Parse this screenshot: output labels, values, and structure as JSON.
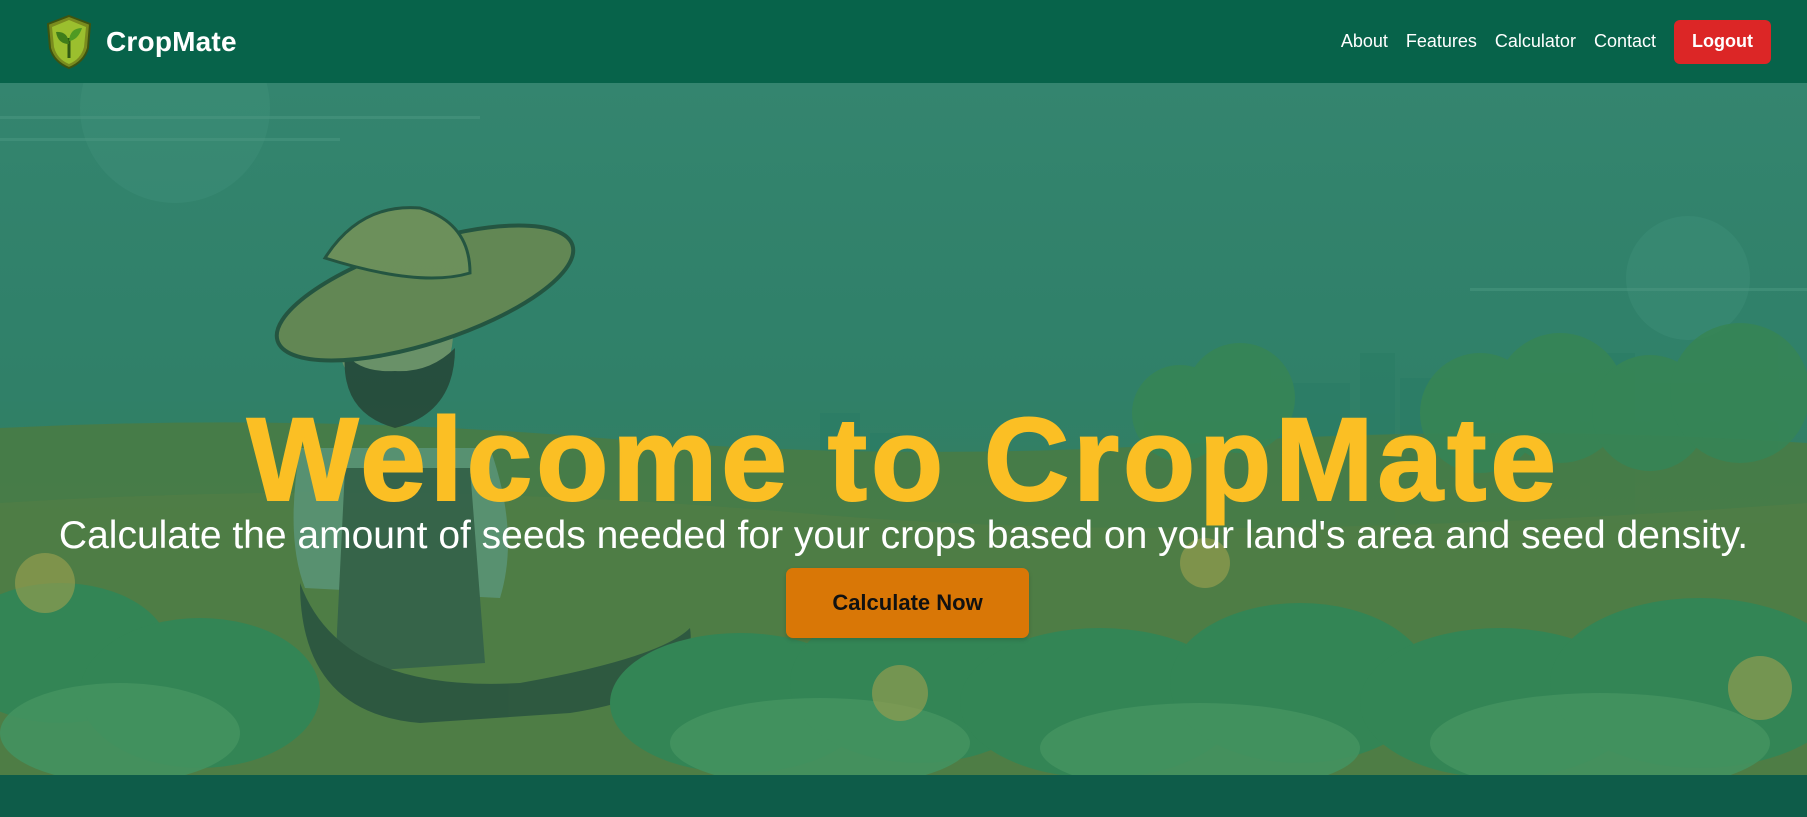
{
  "brand": {
    "name": "CropMate",
    "logo_icon": "leaf-shield-icon"
  },
  "nav": {
    "links": [
      {
        "label": "About"
      },
      {
        "label": "Features"
      },
      {
        "label": "Calculator"
      },
      {
        "label": "Contact"
      }
    ],
    "logout_label": "Logout"
  },
  "hero": {
    "title": "Welcome to CropMate",
    "subtitle": "Calculate the amount of seeds needed for your crops based on your land's area and seed density.",
    "cta_label": "Calculate Now",
    "illustration": "farmer-in-field-illustration"
  },
  "colors": {
    "navbar": "#07634a",
    "title": "#fbbf24",
    "cta": "#d97706",
    "logout": "#dc2626"
  }
}
